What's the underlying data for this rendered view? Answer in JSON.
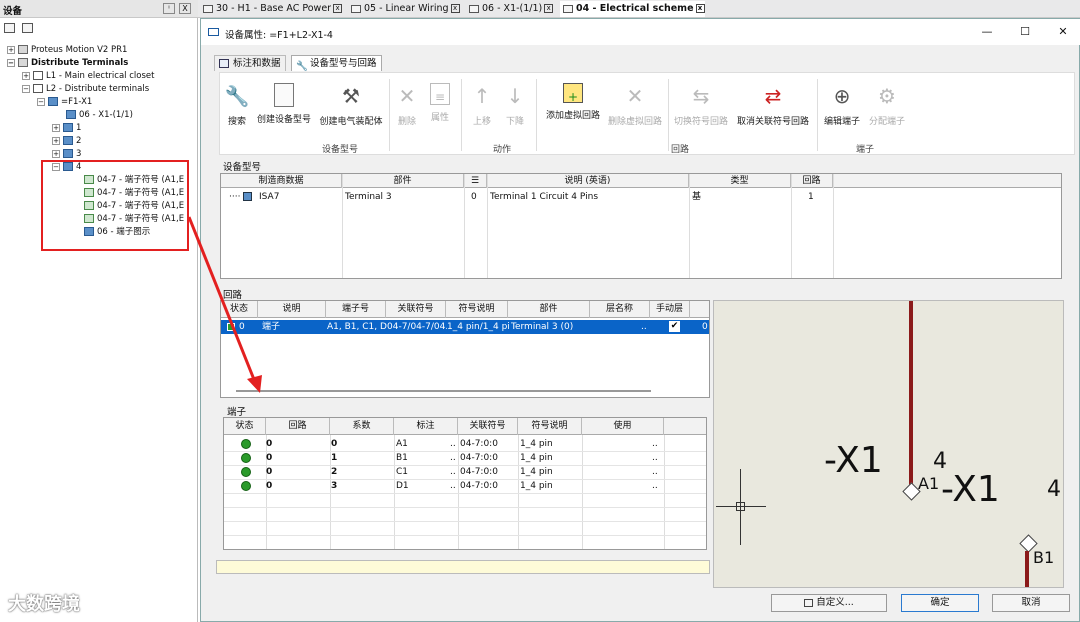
{
  "panel": {
    "title": "设备",
    "pin": "ᴵᴾ",
    "close": "X",
    "tree": [
      {
        "label": "Proteus Motion V2 PR1"
      },
      {
        "label": "Distribute Terminals"
      },
      {
        "label": "L1 - Main electrical closet"
      },
      {
        "label": "L2 - Distribute terminals"
      },
      {
        "label": "=F1-X1"
      },
      {
        "label": "06 - X1-(1/1)"
      },
      {
        "label": "1"
      },
      {
        "label": "2"
      },
      {
        "label": "3"
      },
      {
        "label": "4"
      },
      {
        "label": "04-7 - 端子符号 (A1,E"
      },
      {
        "label": "04-7 - 端子符号 (A1,E"
      },
      {
        "label": "04-7 - 端子符号 (A1,E"
      },
      {
        "label": "04-7 - 端子符号 (A1,E"
      },
      {
        "label": "06 - 端子图示"
      }
    ]
  },
  "tabs": [
    {
      "label": "30 - H1 - Base AC Power"
    },
    {
      "label": "05 - Linear Wiring"
    },
    {
      "label": "06 - X1-(1/1)"
    },
    {
      "label": "04 - Electrical scheme"
    }
  ],
  "dialog": {
    "title": "设备属性: =F1+L2-X1-4",
    "subtabs": [
      "标注和数据",
      "设备型号与回路"
    ],
    "ribbon": {
      "buttons": [
        {
          "label": "搜索"
        },
        {
          "label": "创建设备型号"
        },
        {
          "label": "创建电气装配体"
        },
        {
          "label": "删除"
        },
        {
          "label": "属性"
        },
        {
          "label": "上移"
        },
        {
          "label": "下降"
        },
        {
          "label": "添加虚拟回路"
        },
        {
          "label": "删除虚拟回路"
        },
        {
          "label": "切换符号回路"
        },
        {
          "label": "取消关联符号回路"
        },
        {
          "label": "编辑端子"
        },
        {
          "label": "分配端子"
        }
      ],
      "groups": [
        "设备型号",
        "动作",
        "回路",
        "端子"
      ]
    },
    "device_section": {
      "title": "设备型号",
      "columns": [
        "制造商数据",
        "部件",
        "",
        "说明 (英语)",
        "类型",
        "回路"
      ],
      "rows": [
        {
          "mfr": "ISA7",
          "part": "Terminal 3",
          "idx": "0",
          "desc": "Terminal 1 Circuit 4 Pins",
          "type": "基",
          "circuits": "1"
        }
      ]
    },
    "circuit_section": {
      "title": "回路",
      "columns": [
        "状态",
        "说明",
        "端子号",
        "关联符号",
        "符号说明",
        "部件",
        "层名称",
        "手动层"
      ],
      "rows": [
        {
          "status": "0",
          "desc": "端子",
          "terminals": "A1, B1, C1, D1",
          "symbols": "04-7/04-7/04...",
          "symdesc": "1_4 pin/1_4 pi...",
          "part": "Terminal 3 (0)",
          "layer": "..",
          "manual": "✔",
          "extra": "0"
        }
      ]
    },
    "terminal_section": {
      "title": "端子",
      "columns": [
        "状态",
        "回路",
        "系数",
        "标注",
        "关联符号",
        "符号说明",
        "使用"
      ],
      "rows": [
        {
          "circuit": "0",
          "coef": "0",
          "mark": "A1",
          "symbol": "04-7:0:0",
          "symdesc": "1_4 pin",
          "use": ".."
        },
        {
          "circuit": "0",
          "coef": "1",
          "mark": "B1",
          "symbol": "04-7:0:0",
          "symdesc": "1_4 pin",
          "use": ".."
        },
        {
          "circuit": "0",
          "coef": "2",
          "mark": "C1",
          "symbol": "04-7:0:0",
          "symdesc": "1_4 pin",
          "use": ".."
        },
        {
          "circuit": "0",
          "coef": "3",
          "mark": "D1",
          "symbol": "04-7:0:0",
          "symdesc": "1_4 pin",
          "use": ".."
        }
      ]
    },
    "preview": {
      "label1": "-X1",
      "label2": "-X1",
      "num1": "4",
      "num2": "4",
      "pin1": "A1",
      "pin2": "B1"
    },
    "buttons": {
      "custom": "自定义...",
      "ok": "确定",
      "cancel": "取消"
    }
  },
  "watermark": "大数跨境",
  "colors": {
    "selection": "#0a64c8",
    "status_ok": "#2a9a2a",
    "highlight": "#e32020",
    "wire": "#8b1a1a"
  }
}
